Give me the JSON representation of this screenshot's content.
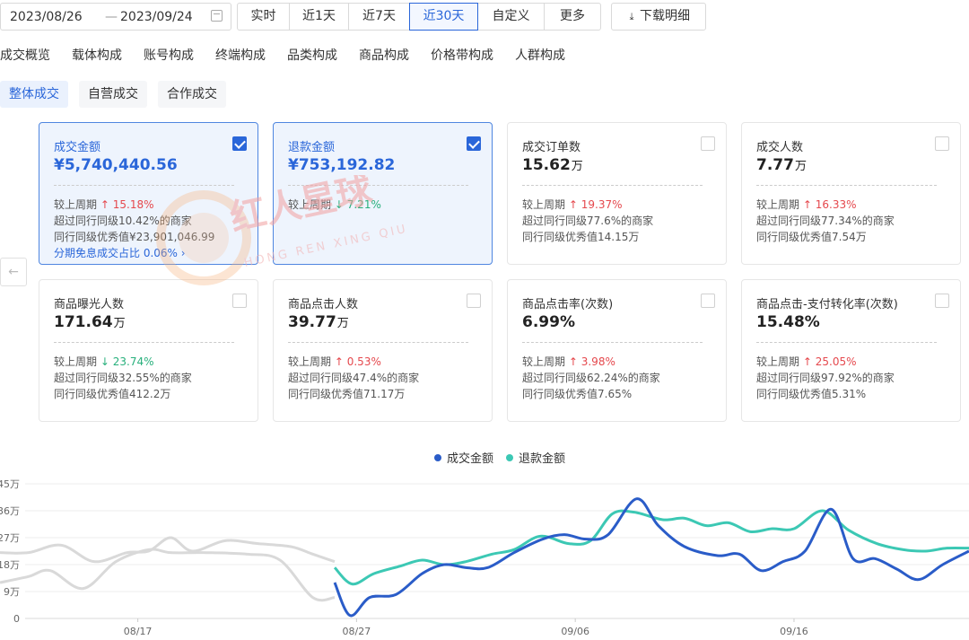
{
  "date_range": {
    "start": "2023/08/26",
    "separator": "—",
    "end": "2023/09/24"
  },
  "period_buttons": [
    "实时",
    "近1天",
    "近7天",
    "近30天",
    "自定义",
    "更多"
  ],
  "active_period": "近30天",
  "download_label": "下载明细",
  "tabs": [
    "成交概览",
    "载体构成",
    "账号构成",
    "终端构成",
    "品类构成",
    "商品构成",
    "价格带构成",
    "人群构成"
  ],
  "subtabs": [
    "整体成交",
    "自营成交",
    "合作成交"
  ],
  "cards": [
    {
      "title": "成交金额",
      "value": "¥5,740,440.56",
      "unit": "",
      "selected": true,
      "cmp_label": "较上周期",
      "cmp_dir": "up",
      "cmp_value": "15.18%",
      "line2": "超过同行同级10.42%的商家",
      "line3": "同行同级优秀值¥23,901,046.99",
      "line4": "分期免息成交占比 0.06%"
    },
    {
      "title": "退款金额",
      "value": "¥753,192.82",
      "unit": "",
      "selected": true,
      "cmp_label": "较上周期",
      "cmp_dir": "down",
      "cmp_value": "7.21%",
      "line2": "",
      "line3": "",
      "line4": ""
    },
    {
      "title": "成交订单数",
      "value": "15.62",
      "unit": "万",
      "selected": false,
      "cmp_label": "较上周期",
      "cmp_dir": "up",
      "cmp_value": "19.37%",
      "line2": "超过同行同级77.6%的商家",
      "line3": "同行同级优秀值14.15万",
      "line4": ""
    },
    {
      "title": "成交人数",
      "value": "7.77",
      "unit": "万",
      "selected": false,
      "cmp_label": "较上周期",
      "cmp_dir": "up",
      "cmp_value": "16.33%",
      "line2": "超过同行同级77.34%的商家",
      "line3": "同行同级优秀值7.54万",
      "line4": ""
    },
    {
      "title": "商品曝光人数",
      "value": "171.64",
      "unit": "万",
      "selected": false,
      "cmp_label": "较上周期",
      "cmp_dir": "down",
      "cmp_value": "23.74%",
      "line2": "超过同行同级32.55%的商家",
      "line3": "同行同级优秀值412.2万",
      "line4": ""
    },
    {
      "title": "商品点击人数",
      "value": "39.77",
      "unit": "万",
      "selected": false,
      "cmp_label": "较上周期",
      "cmp_dir": "up",
      "cmp_value": "0.53%",
      "line2": "超过同行同级47.4%的商家",
      "line3": "同行同级优秀值71.17万",
      "line4": ""
    },
    {
      "title": "商品点击率(次数)",
      "value": "6.99%",
      "unit": "",
      "selected": false,
      "cmp_label": "较上周期",
      "cmp_dir": "up",
      "cmp_value": "3.98%",
      "line2": "超过同行同级62.24%的商家",
      "line3": "同行同级优秀值7.65%",
      "line4": ""
    },
    {
      "title": "商品点击-支付转化率(次数)",
      "value": "15.48%",
      "unit": "",
      "selected": false,
      "cmp_label": "较上周期",
      "cmp_dir": "up",
      "cmp_value": "25.05%",
      "line2": "超过同行同级97.92%的商家",
      "line3": "同行同级优秀值5.31%",
      "line4": ""
    }
  ],
  "watermark": {
    "cn": "红人星球",
    "en": "HONG REN XING QIU"
  },
  "colors": {
    "primary": "#2a66d9",
    "refund": "#3cc8b4",
    "previous": "#d9d9d9",
    "up": "#e5484d",
    "down": "#28b07c"
  },
  "chart_data": {
    "type": "line",
    "legend": [
      {
        "name": "成交金额",
        "color": "#2a5cc8"
      },
      {
        "name": "退款金额",
        "color": "#3cc8b4"
      }
    ],
    "y_ticks": [
      "0",
      "9万",
      "18万",
      "27万",
      "36万",
      "45万"
    ],
    "ylim": [
      0,
      45
    ],
    "x_ticks": [
      {
        "label": "08/17",
        "x": -9
      },
      {
        "label": "08/27",
        "x": 1
      },
      {
        "label": "09/06",
        "x": 11
      },
      {
        "label": "09/16",
        "x": 21
      }
    ],
    "xlim": [
      -15.3,
      29
    ],
    "previous_series": {
      "a": [
        [
          -15.3,
          22
        ],
        [
          -14,
          22
        ],
        [
          -12.5,
          24.5
        ],
        [
          -11,
          19
        ],
        [
          -9.5,
          22
        ],
        [
          -8.5,
          22.5
        ],
        [
          -7.5,
          27
        ],
        [
          -6.5,
          22.5
        ],
        [
          -5,
          26
        ],
        [
          -3.5,
          25
        ],
        [
          -2,
          24
        ],
        [
          -1,
          21.5
        ],
        [
          0,
          19
        ]
      ],
      "b": [
        [
          -15.3,
          12
        ],
        [
          -14,
          14
        ],
        [
          -13,
          16
        ],
        [
          -11.5,
          10
        ],
        [
          -10,
          19
        ],
        [
          -8.5,
          23
        ],
        [
          -7.5,
          22
        ],
        [
          -6,
          22
        ],
        [
          -4,
          21.5
        ],
        [
          -2.5,
          19.5
        ],
        [
          -1,
          7
        ],
        [
          0,
          7
        ]
      ]
    },
    "series": [
      {
        "name": "成交金额",
        "points": [
          [
            0,
            12
          ],
          [
            0.7,
            1
          ],
          [
            1.6,
            7
          ],
          [
            2.8,
            8
          ],
          [
            4,
            15
          ],
          [
            5,
            18
          ],
          [
            6,
            17
          ],
          [
            7,
            17
          ],
          [
            8.2,
            22
          ],
          [
            9.5,
            26.5
          ],
          [
            10.5,
            28
          ],
          [
            11.5,
            26.5
          ],
          [
            12.5,
            28
          ],
          [
            13.8,
            40
          ],
          [
            14.8,
            31
          ],
          [
            16,
            24
          ],
          [
            17.5,
            21
          ],
          [
            18.5,
            21.5
          ],
          [
            19.5,
            16
          ],
          [
            20.5,
            19
          ],
          [
            21.5,
            22.5
          ],
          [
            22.7,
            36.5
          ],
          [
            23.7,
            20
          ],
          [
            24.7,
            20
          ],
          [
            25.7,
            16.5
          ],
          [
            26.7,
            13
          ],
          [
            27.8,
            18
          ],
          [
            29,
            22.5
          ]
        ]
      },
      {
        "name": "退款金额",
        "points": [
          [
            0,
            17
          ],
          [
            0.8,
            11.5
          ],
          [
            1.8,
            15
          ],
          [
            3,
            17.5
          ],
          [
            4,
            19.5
          ],
          [
            5,
            18
          ],
          [
            6,
            19
          ],
          [
            7.2,
            21.5
          ],
          [
            8.2,
            23
          ],
          [
            9.4,
            27.5
          ],
          [
            10.7,
            25
          ],
          [
            11.7,
            26
          ],
          [
            12.7,
            35
          ],
          [
            13.7,
            35.5
          ],
          [
            15,
            33
          ],
          [
            16,
            33.5
          ],
          [
            17,
            31
          ],
          [
            18,
            32
          ],
          [
            19,
            29
          ],
          [
            20,
            30
          ],
          [
            21,
            30
          ],
          [
            22.3,
            36
          ],
          [
            23.5,
            29.5
          ],
          [
            24.8,
            25
          ],
          [
            26,
            23
          ],
          [
            27,
            22.5
          ],
          [
            28,
            23.5
          ],
          [
            29,
            23.5
          ]
        ]
      }
    ]
  }
}
